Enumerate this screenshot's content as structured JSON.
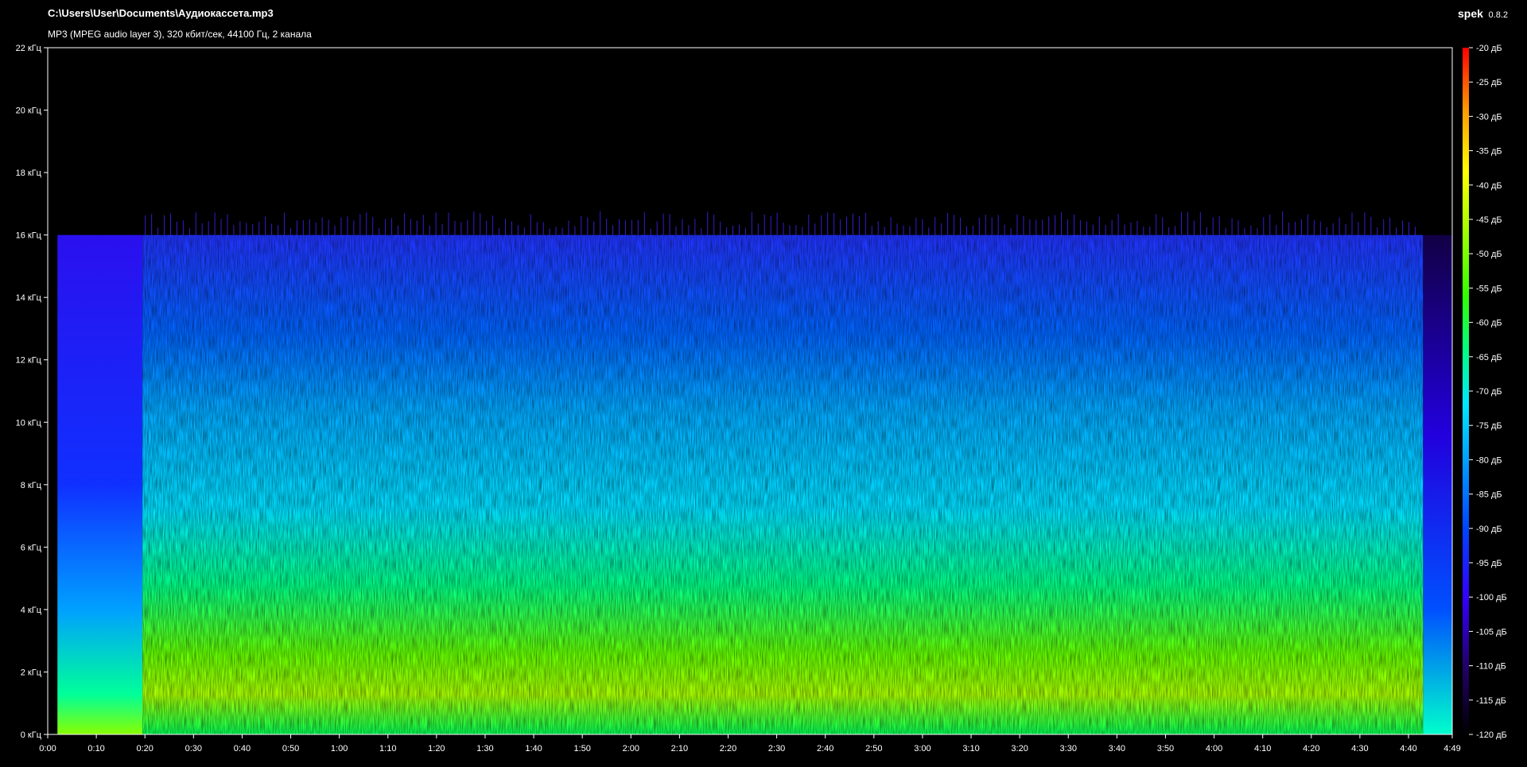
{
  "header": {
    "file_path": "C:\\Users\\User\\Documents\\Аудиокассета.mp3",
    "file_info": "MP3 (MPEG audio layer 3), 320 кбит/сек, 44100 Гц, 2 канала"
  },
  "app": {
    "name": "spek",
    "version": "0.8.2"
  },
  "chart_data": {
    "type": "heatmap",
    "x_ticks": [
      "0:00",
      "0:10",
      "0:20",
      "0:30",
      "0:40",
      "0:50",
      "1:00",
      "1:10",
      "1:20",
      "1:30",
      "1:40",
      "1:50",
      "2:00",
      "2:10",
      "2:20",
      "2:30",
      "2:40",
      "2:50",
      "3:00",
      "3:10",
      "3:20",
      "3:30",
      "3:40",
      "3:50",
      "4:00",
      "4:10",
      "4:20",
      "4:30",
      "4:40",
      "4:49"
    ],
    "x_tick_seconds": [
      0,
      10,
      20,
      30,
      40,
      50,
      60,
      70,
      80,
      90,
      100,
      110,
      120,
      130,
      140,
      150,
      160,
      170,
      180,
      190,
      200,
      210,
      220,
      230,
      240,
      250,
      260,
      270,
      280,
      289
    ],
    "xlim": [
      0,
      289
    ],
    "y_ticks": [
      "0 кГц",
      "2 кГц",
      "4 кГц",
      "6 кГц",
      "8 кГц",
      "10 кГц",
      "12 кГц",
      "14 кГц",
      "16 кГц",
      "18 кГц",
      "20 кГц",
      "22 кГц"
    ],
    "y_tick_khz": [
      0,
      2,
      4,
      6,
      8,
      10,
      12,
      14,
      16,
      18,
      20,
      22
    ],
    "ylim": [
      0,
      22
    ],
    "colorbar_ticks": [
      "-20 дБ",
      "-25 дБ",
      "-30 дБ",
      "-35 дБ",
      "-40 дБ",
      "-45 дБ",
      "-50 дБ",
      "-55 дБ",
      "-60 дБ",
      "-65 дБ",
      "-70 дБ",
      "-75 дБ",
      "-80 дБ",
      "-85 дБ",
      "-90 дБ",
      "-95 дБ",
      "-100 дБ",
      "-105 дБ",
      "-110 дБ",
      "-115 дБ",
      "-120 дБ"
    ],
    "colorbar_db": [
      -20,
      -25,
      -30,
      -35,
      -40,
      -45,
      -50,
      -55,
      -60,
      -65,
      -70,
      -75,
      -80,
      -85,
      -90,
      -95,
      -100,
      -105,
      -110,
      -115,
      -120
    ],
    "color_range_db": [
      -120,
      -20
    ],
    "cutoff_khz": 16,
    "colormap": [
      "#000000",
      "#1a0066",
      "#2a00ff",
      "#0044ff",
      "#00a0ff",
      "#00e5ff",
      "#00ff88",
      "#33ff00",
      "#aaff00",
      "#ffff00",
      "#ff9900",
      "#ff0000"
    ]
  }
}
